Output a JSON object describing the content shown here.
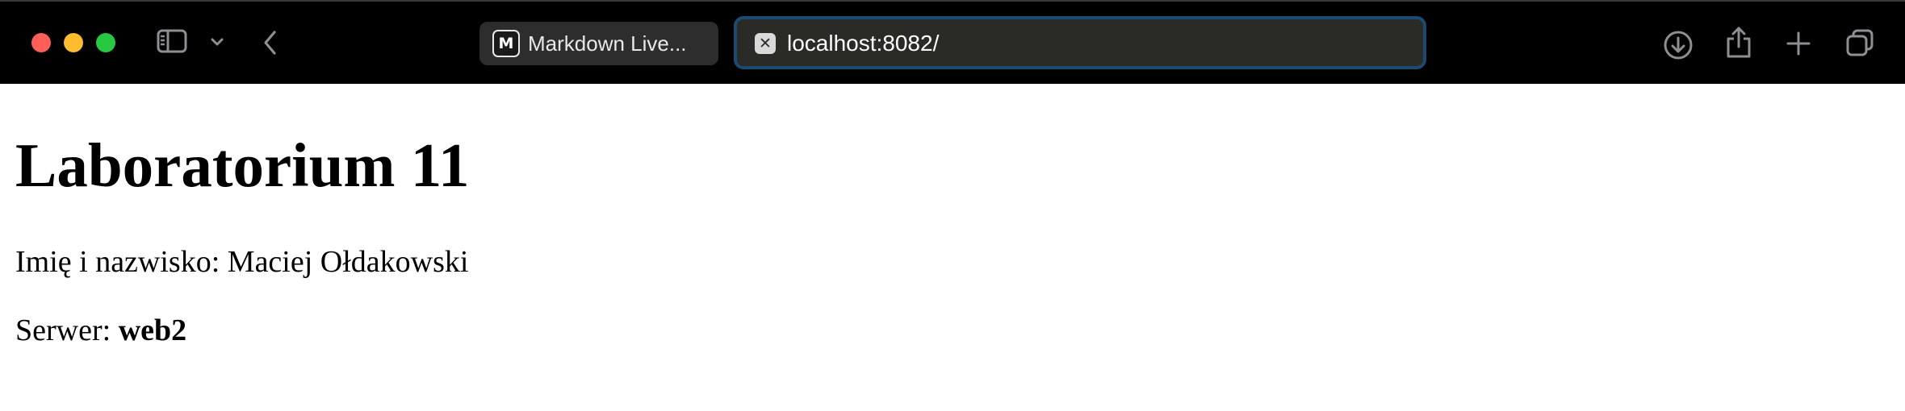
{
  "browser": {
    "tab": {
      "favicon_letter": "M",
      "title": "Markdown Live..."
    },
    "address_bar": {
      "url": "localhost:8082/",
      "favicon_glyph": "✕"
    },
    "icons": {
      "sidebar": "sidebar-icon",
      "sidebar_menu": "chevron-down-icon",
      "back": "chevron-left-icon",
      "downloads": "download-icon",
      "share": "share-icon",
      "new_tab": "plus-icon",
      "tab_overview": "tabs-overview-icon"
    },
    "colors": {
      "toolbar": "#000000",
      "close": "#ff5f57",
      "minimize": "#febc2e",
      "zoom": "#28c840",
      "address_focus_ring": "#1b4b70"
    }
  },
  "page": {
    "title": "Laboratorium 11",
    "name_label": "Imię i nazwisko: ",
    "name_value": "Maciej Ołdakowski",
    "server_label": "Serwer: ",
    "server_value": "web2"
  }
}
